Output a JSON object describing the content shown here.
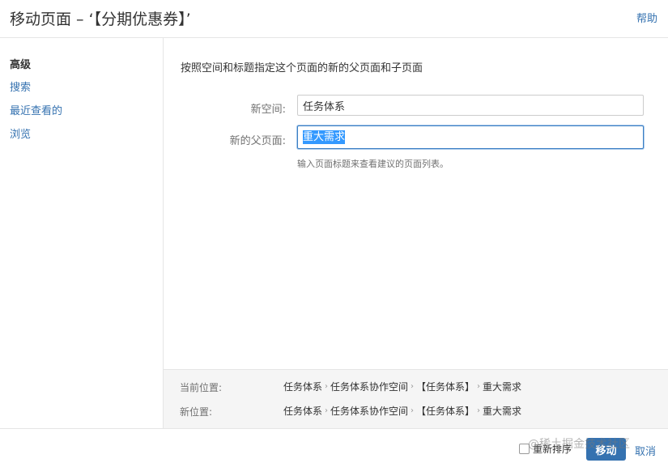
{
  "dialog": {
    "title": "移动页面 – ‘【分期优惠券】’",
    "help_label": "帮助"
  },
  "sidebar": {
    "items": [
      {
        "label": "高级",
        "active": true
      },
      {
        "label": "搜索",
        "active": false
      },
      {
        "label": "最近查看的",
        "active": false
      },
      {
        "label": "浏览",
        "active": false
      }
    ]
  },
  "main": {
    "instruction": "按照空间和标题指定这个页面的新的父页面和子页面",
    "space_label": "新空间:",
    "space_value": "任务体系",
    "parent_label": "新的父页面:",
    "parent_value": "重大需求",
    "hint": "输入页面标题来查看建议的页面列表。"
  },
  "location": {
    "current_label": "当前位置:",
    "current_path": [
      "任务体系",
      "任务体系协作空间",
      "【任务体系】",
      "重大需求"
    ],
    "new_label": "新位置:",
    "new_path": [
      "任务体系",
      "任务体系协作空间",
      "【任务体系】",
      "重大需求"
    ]
  },
  "footer": {
    "reorder_label": "重新排序",
    "move_label": "移动",
    "cancel_label": "取消"
  },
  "watermark": "@稀土掘金技术社区"
}
